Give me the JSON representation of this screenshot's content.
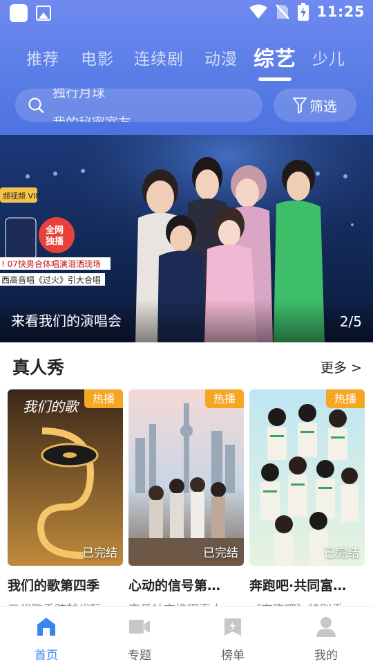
{
  "status_bar": {
    "time": "11:25"
  },
  "tabs": [
    {
      "label": "推荐",
      "active": false
    },
    {
      "label": "电影",
      "active": false
    },
    {
      "label": "连续剧",
      "active": false
    },
    {
      "label": "动漫",
      "active": false
    },
    {
      "label": "综艺",
      "active": true
    },
    {
      "label": "少儿",
      "active": false
    }
  ],
  "search": {
    "rotating_hints": [
      "独行月球",
      "我的秘密室友"
    ]
  },
  "filter_button": {
    "label": "筛选"
  },
  "banner": {
    "title": "来看我们的演唱会",
    "counter": "2/5",
    "poster_texts": {
      "vip_tag": "频视频 VIP",
      "exclusive": "全网独播",
      "line1": "! 07快男合体唱演泪洒现场",
      "line2": "西高音唱《过火》引大合唱"
    }
  },
  "section": {
    "title": "真人秀",
    "more_label": "更多 >"
  },
  "cards": [
    {
      "title": "我们的歌第四季",
      "subtitle": "三代歌手跨越代际",
      "badge": "热播",
      "status": "已完结",
      "poster_text": "我们的歌"
    },
    {
      "title": "心动的信号第…",
      "subtitle": "恋爱社交推理真人",
      "badge": "热播",
      "status": "已完结",
      "poster_text": ""
    },
    {
      "title": "奔跑吧·共同富…",
      "subtitle": "《奔跑吧》特别季",
      "badge": "热播",
      "status": "已完结",
      "poster_text": ""
    }
  ],
  "bottom_nav": [
    {
      "label": "首页",
      "icon": "home-icon",
      "active": true
    },
    {
      "label": "专题",
      "icon": "video-camera-icon",
      "active": false
    },
    {
      "label": "榜单",
      "icon": "ranking-icon",
      "active": false
    },
    {
      "label": "我的",
      "icon": "profile-icon",
      "active": false
    }
  ],
  "colors": {
    "header_top": "#6f8af0",
    "header_bottom": "#4d72e0",
    "hot_badge": "#f5a623",
    "nav_active": "#3a86f0",
    "nav_inactive": "#c7c7c7"
  }
}
